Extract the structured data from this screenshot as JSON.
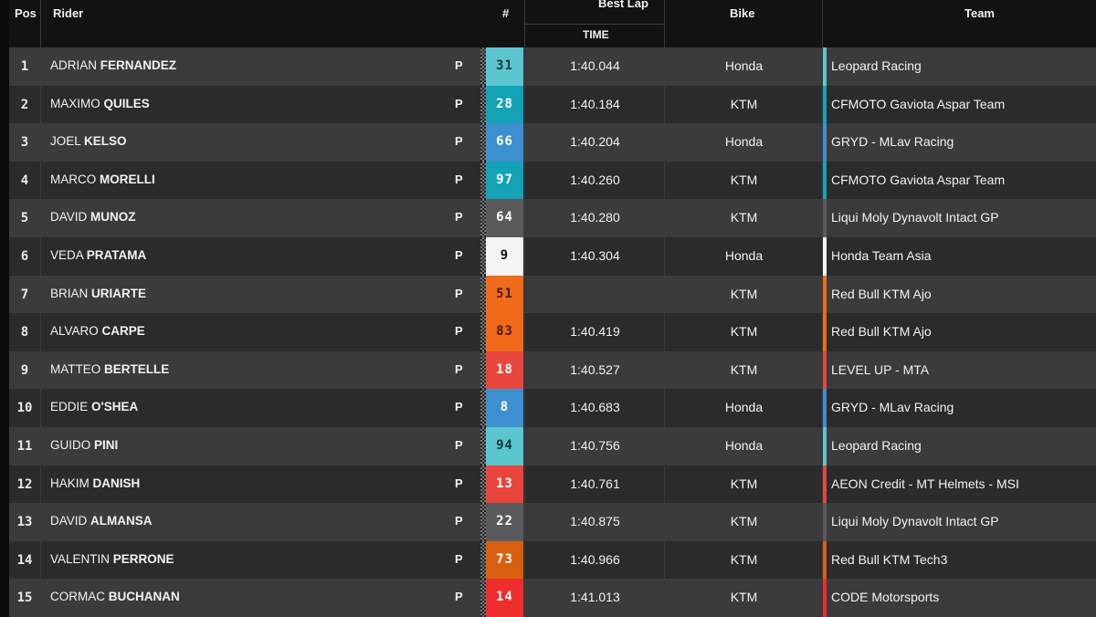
{
  "header": {
    "pos": "Pos",
    "rider": "Rider",
    "number": "#",
    "best_lap": "Best Lap",
    "time": "TIME",
    "bike": "Bike",
    "team": "Team"
  },
  "colors": {
    "teal_light": "#5bc6cf",
    "teal_dark": "#14a2b6",
    "blue": "#3d8fcf",
    "white": "#f4f4f4",
    "grey": "#5a5a5c",
    "orange": "#f06a1a",
    "orange_dark": "#d95f10",
    "red": "#e8453c",
    "red_bright": "#ef2d2d"
  },
  "rows": [
    {
      "pos": "1",
      "first": "ADRIAN",
      "last": "FERNANDEZ",
      "icon": "P",
      "number": "31",
      "num_bg": "#5bc6cf",
      "num_fg": "#10363a",
      "time": "1:40.044",
      "bike": "Honda",
      "team": "Leopard Racing",
      "team_color": "#5bc6cf"
    },
    {
      "pos": "2",
      "first": "MAXIMO",
      "last": "QUILES",
      "icon": "P",
      "number": "28",
      "num_bg": "#14a2b6",
      "num_fg": "#ffffff",
      "time": "1:40.184",
      "bike": "KTM",
      "team": "CFMOTO Gaviota Aspar Team",
      "team_color": "#14a2b6"
    },
    {
      "pos": "3",
      "first": "JOEL",
      "last": "KELSO",
      "icon": "P",
      "number": "66",
      "num_bg": "#3d8fcf",
      "num_fg": "#ffffff",
      "time": "1:40.204",
      "bike": "Honda",
      "team": "GRYD - MLav Racing",
      "team_color": "#3d8fcf"
    },
    {
      "pos": "4",
      "first": "MARCO",
      "last": "MORELLI",
      "icon": "P",
      "number": "97",
      "num_bg": "#14a2b6",
      "num_fg": "#ffffff",
      "time": "1:40.260",
      "bike": "KTM",
      "team": "CFMOTO Gaviota Aspar Team",
      "team_color": "#14a2b6"
    },
    {
      "pos": "5",
      "first": "DAVID",
      "last": "MUNOZ",
      "icon": "P",
      "number": "64",
      "num_bg": "#5a5a5c",
      "num_fg": "#ffffff",
      "time": "1:40.280",
      "bike": "KTM",
      "team": "Liqui Moly Dynavolt Intact GP",
      "team_color": "#5a5a5c"
    },
    {
      "pos": "6",
      "first": "VEDA",
      "last": "PRATAMA",
      "icon": "P",
      "number": "9",
      "num_bg": "#f4f4f4",
      "num_fg": "#111111",
      "time": "1:40.304",
      "bike": "Honda",
      "team": "Honda Team Asia",
      "team_color": "#f4f4f4"
    },
    {
      "pos": "7",
      "first": "BRIAN",
      "last": "URIARTE",
      "icon": "P",
      "number": "51",
      "num_bg": "#f06a1a",
      "num_fg": "#4a1a00",
      "time": "",
      "bike": "KTM",
      "team": "Red Bull KTM Ajo",
      "team_color": "#f06a1a"
    },
    {
      "pos": "8",
      "first": "ALVARO",
      "last": "CARPE",
      "icon": "P",
      "number": "83",
      "num_bg": "#f06a1a",
      "num_fg": "#4a1a00",
      "time": "1:40.419",
      "bike": "KTM",
      "team": "Red Bull KTM Ajo",
      "team_color": "#f06a1a"
    },
    {
      "pos": "9",
      "first": "MATTEO",
      "last": "BERTELLE",
      "icon": "P",
      "number": "18",
      "num_bg": "#e8453c",
      "num_fg": "#ffffff",
      "time": "1:40.527",
      "bike": "KTM",
      "team": "LEVEL UP - MTA",
      "team_color": "#e8453c"
    },
    {
      "pos": "10",
      "first": "EDDIE",
      "last": "O'SHEA",
      "icon": "P",
      "number": "8",
      "num_bg": "#3d8fcf",
      "num_fg": "#ffffff",
      "time": "1:40.683",
      "bike": "Honda",
      "team": "GRYD - MLav Racing",
      "team_color": "#3d8fcf"
    },
    {
      "pos": "11",
      "first": "GUIDO",
      "last": "PINI",
      "icon": "P",
      "number": "94",
      "num_bg": "#5bc6cf",
      "num_fg": "#10363a",
      "time": "1:40.756",
      "bike": "Honda",
      "team": "Leopard Racing",
      "team_color": "#5bc6cf"
    },
    {
      "pos": "12",
      "first": "HAKIM",
      "last": "DANISH",
      "icon": "P",
      "number": "13",
      "num_bg": "#e8453c",
      "num_fg": "#ffffff",
      "time": "1:40.761",
      "bike": "KTM",
      "team": "AEON Credit - MT Helmets - MSI",
      "team_color": "#e8453c"
    },
    {
      "pos": "13",
      "first": "DAVID",
      "last": "ALMANSA",
      "icon": "P",
      "number": "22",
      "num_bg": "#5a5a5c",
      "num_fg": "#ffffff",
      "time": "1:40.875",
      "bike": "KTM",
      "team": "Liqui Moly Dynavolt Intact GP",
      "team_color": "#5a5a5c"
    },
    {
      "pos": "14",
      "first": "VALENTIN",
      "last": "PERRONE",
      "icon": "P",
      "number": "73",
      "num_bg": "#d95f10",
      "num_fg": "#ffffff",
      "time": "1:40.966",
      "bike": "KTM",
      "team": "Red Bull KTM Tech3",
      "team_color": "#d95f10"
    },
    {
      "pos": "15",
      "first": "CORMAC",
      "last": "BUCHANAN",
      "icon": "P",
      "number": "14",
      "num_bg": "#ef2d2d",
      "num_fg": "#ffffff",
      "time": "1:41.013",
      "bike": "KTM",
      "team": "CODE Motorsports",
      "team_color": "#ef2d2d"
    }
  ]
}
